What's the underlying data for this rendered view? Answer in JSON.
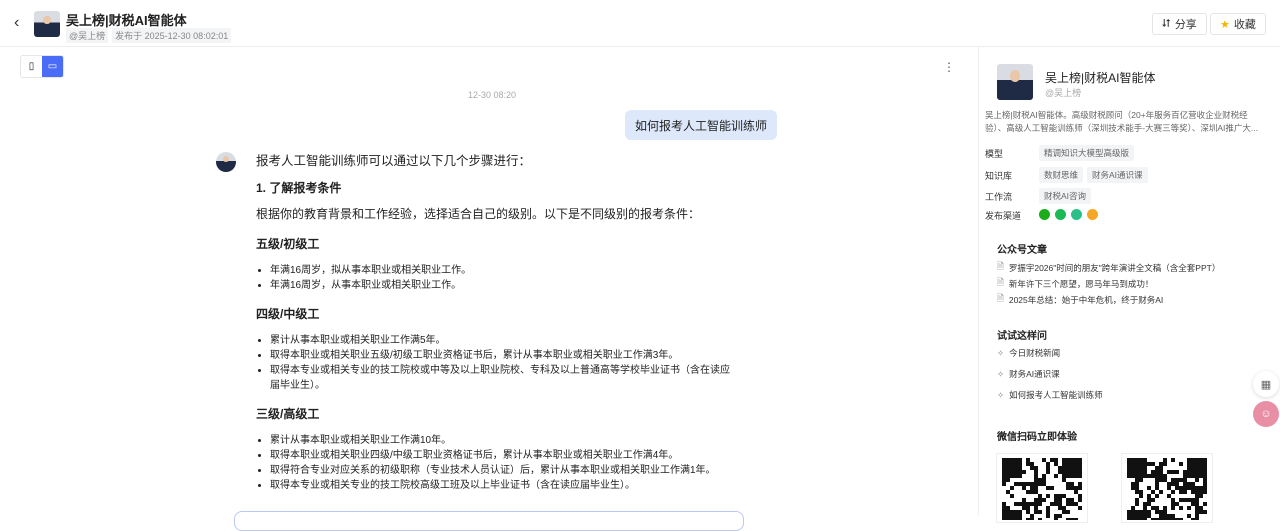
{
  "header": {
    "back_icon": "chevron-left-icon",
    "title": "吴上榜|财税AI智能体",
    "author": "@吴上榜",
    "published": "发布于 2025-12-30 08:02:01",
    "share": "分享",
    "favorite": "收藏"
  },
  "chat": {
    "timestamp": "12-30 08:20",
    "user_message": "如何报考人工智能训练师",
    "answer": {
      "intro": "报考人工智能训练师可以通过以下几个步骤进行：",
      "step1": "1. 了解报考条件",
      "step1_desc": "根据你的教育背景和工作经验，选择适合自己的级别。以下是不同级别的报考条件：",
      "levels": [
        {
          "title": "五级/初级工",
          "items": [
            "年满16周岁，拟从事本职业或相关职业工作。",
            "年满16周岁，从事本职业或相关职业工作。"
          ]
        },
        {
          "title": "四级/中级工",
          "items": [
            "累计从事本职业或相关职业工作满5年。",
            "取得本职业或相关职业五级/初级工职业资格证书后，累计从事本职业或相关职业工作满3年。",
            "取得本专业或相关专业的技工院校或中等及以上职业院校、专科及以上普通高等学校毕业证书（含在读应届毕业生）。"
          ]
        },
        {
          "title": "三级/高级工",
          "items": [
            "累计从事本职业或相关职业工作满10年。",
            "取得本职业或相关职业四级/中级工职业资格证书后，累计从事本职业或相关职业工作满4年。",
            "取得符合专业对应关系的初级职称（专业技术人员认证）后，累计从事本职业或相关职业工作满1年。",
            "取得本专业或相关专业的技工院校高级工班及以上毕业证书（含在读应届毕业生）。"
          ]
        }
      ]
    }
  },
  "sidebar": {
    "name": "吴上榜|财税AI智能体",
    "handle": "@吴上榜",
    "description": "吴上榜|财税AI智能体。高级财税顾问（20+年服务百亿营收企业财税经验）、高级人工智能训练师（深圳技术能手-大赛三等奖）、深圳AI推广大...",
    "model_label": "模型",
    "model": "精调知识大模型高级版",
    "kb_label": "知识库",
    "kbs": [
      "数财思维",
      "财务AI通识课"
    ],
    "workflow_label": "工作流",
    "workflow": "财税AI咨询",
    "channels_label": "发布渠道",
    "channels": [
      {
        "name": "wechat",
        "color": "#1aad19"
      },
      {
        "name": "feishu-doc",
        "color": "#19b955"
      },
      {
        "name": "app",
        "color": "#2bbf8a"
      },
      {
        "name": "multi",
        "color": "#f5a623"
      }
    ],
    "articles_title": "公众号文章",
    "articles": [
      "罗振宇2026\"时间的朋友\"跨年演讲全文稿（含全套PPT）",
      "新年许下三个愿望，愿马年马到成功！",
      "2025年总结：始于中年危机，终于财务AI"
    ],
    "try_title": "试试这样问",
    "try": [
      "今日财税新闻",
      "财务AI通识课",
      "如何报考人工智能训练师"
    ],
    "qr_title": "微信扫码立即体验"
  },
  "colors": {
    "accent": "#4a6cf7",
    "bubble": "#dde8fb"
  }
}
